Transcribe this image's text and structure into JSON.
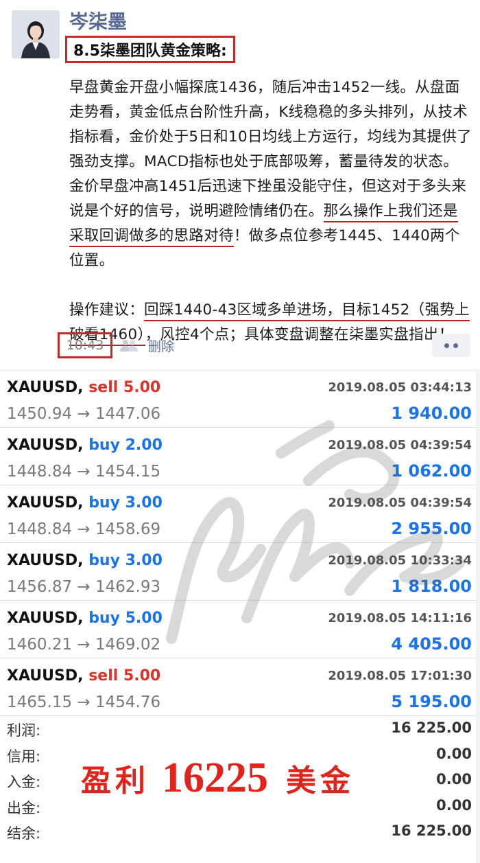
{
  "post": {
    "author": "岑柒墨",
    "title": "8.5柒墨团队黄金策略:",
    "paragraph1_plain": "早盘黄金开盘小幅探底1436，随后冲击1452一线。从盘面走势看，黄金低点台阶性升高，K线稳稳的多头排列，从技术指标看，金价处于5日和10日均线上方运行，均线为其提供了强劲支撑。MACD指标也处于底部吸筹，蓄量待发的状态。金价早盘冲高1451后迅速下挫虽没能守住，但这对于多头来说是个好的信号，说明避险情绪仍在。",
    "paragraph1_underlined": "那么操作上我们还是采取回调做多的思路对待",
    "paragraph1_tail": "！做多点位参考1445、1440两个位置。",
    "paragraph2_lead": "操作建议：",
    "paragraph2_underlined": "回踩1440-43区域多单进场，目标1452（强势上破看1460）",
    "paragraph2_tail": "，风控4个点；具体变盘调整在柒墨实盘指出！",
    "time": "10:43",
    "delete_label": "删除"
  },
  "trades": [
    {
      "symbol": "XAUUSD,",
      "side": "sell",
      "side_label": "sell 5.00",
      "prices": "1450.94 → 1447.06",
      "datetime": "2019.08.05 03:44:13",
      "profit": "1 940.00"
    },
    {
      "symbol": "XAUUSD,",
      "side": "buy",
      "side_label": "buy 2.00",
      "prices": "1448.84 → 1454.15",
      "datetime": "2019.08.05 04:39:54",
      "profit": "1 062.00"
    },
    {
      "symbol": "XAUUSD,",
      "side": "buy",
      "side_label": "buy 3.00",
      "prices": "1448.84 → 1458.69",
      "datetime": "2019.08.05 04:39:54",
      "profit": "2 955.00"
    },
    {
      "symbol": "XAUUSD,",
      "side": "buy",
      "side_label": "buy 3.00",
      "prices": "1456.87 → 1462.93",
      "datetime": "2019.08.05 10:33:34",
      "profit": "1 818.00"
    },
    {
      "symbol": "XAUUSD,",
      "side": "buy",
      "side_label": "buy 5.00",
      "prices": "1460.21 → 1469.02",
      "datetime": "2019.08.05 14:11:16",
      "profit": "4 405.00"
    },
    {
      "symbol": "XAUUSD,",
      "side": "sell",
      "side_label": "sell 5.00",
      "prices": "1465.15 → 1454.76",
      "datetime": "2019.08.05 17:01:30",
      "profit": "5 195.00"
    }
  ],
  "summary": [
    {
      "label": "利润:",
      "value": "16 225.00"
    },
    {
      "label": "信用:",
      "value": "0.00"
    },
    {
      "label": "入金:",
      "value": "0.00"
    },
    {
      "label": "出金:",
      "value": "0.00"
    },
    {
      "label": "结余:",
      "value": "16 225.00"
    }
  ],
  "overlay": {
    "prefix": "盈利",
    "amount": "16225",
    "suffix": "美金"
  },
  "colors": {
    "link": "#576b95",
    "highlight_border": "#c72828",
    "sell": "#d9342b",
    "buy": "#1a73e8",
    "overlay": "#e0231b"
  }
}
